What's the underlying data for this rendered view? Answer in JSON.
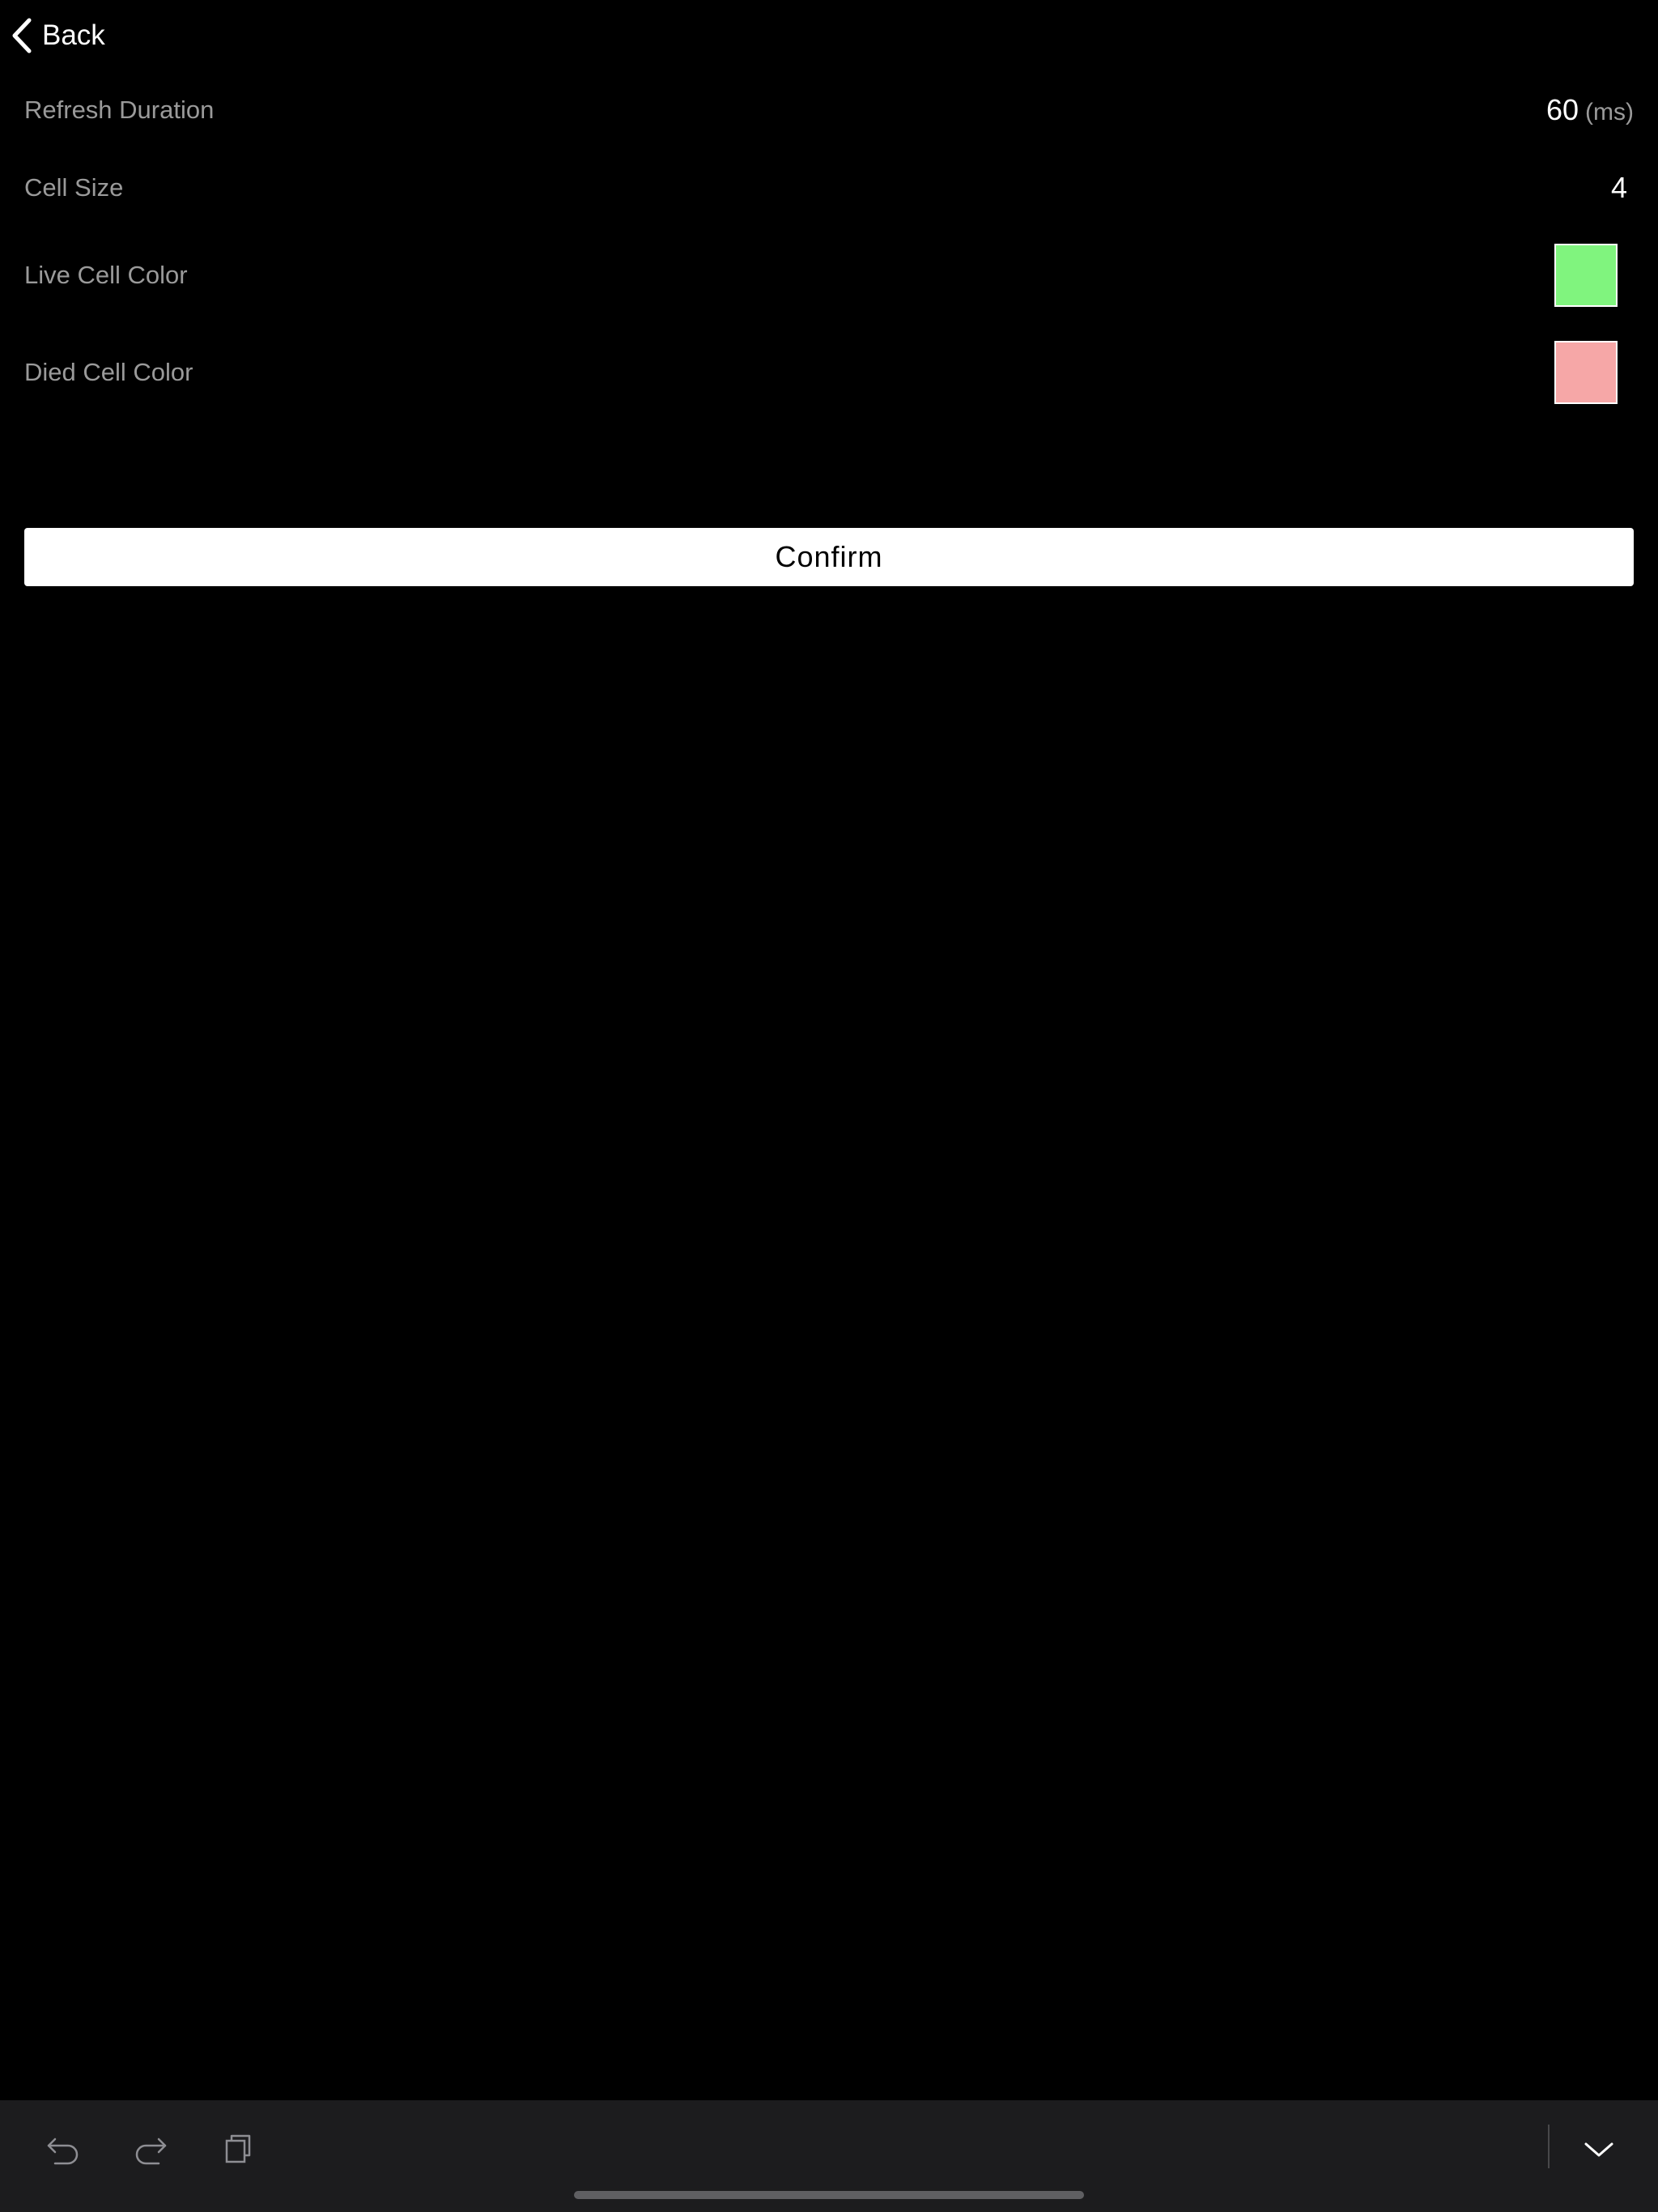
{
  "nav": {
    "back_label": "Back",
    "back_icon": "chevron-left-icon"
  },
  "settings": {
    "refresh_duration": {
      "label": "Refresh Duration",
      "value": "60",
      "unit": "(ms)"
    },
    "cell_size": {
      "label": "Cell Size",
      "value": "4"
    },
    "live_cell_color": {
      "label": "Live Cell Color",
      "color": "#80f47e"
    },
    "died_cell_color": {
      "label": "Died Cell Color",
      "color": "#f6a7a7"
    }
  },
  "confirm": {
    "label": "Confirm"
  },
  "keyboard_toolbar": {
    "icons": [
      "undo-icon",
      "redo-icon",
      "paste-icon",
      "keyboard-dismiss-icon"
    ]
  },
  "colors": {
    "background": "#000000",
    "label_gray": "#9a9a9a",
    "toolbar_bg": "#1c1c1e"
  }
}
